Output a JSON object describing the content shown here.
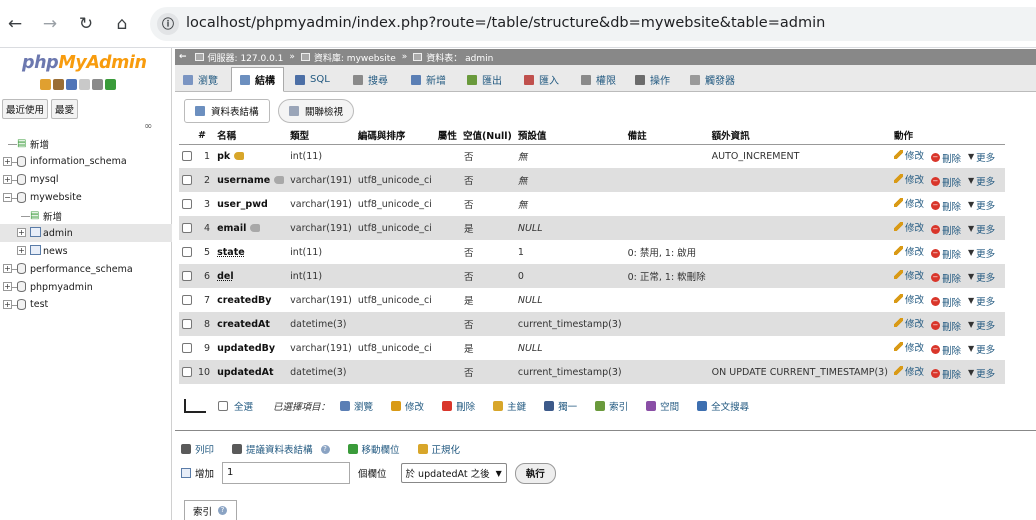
{
  "browser": {
    "url": "localhost/phpmyadmin/index.php?route=/table/structure&db=mywebsite&table=admin",
    "back_glyph": "←",
    "forward_glyph": "→",
    "reload_glyph": "↻",
    "home_glyph": "⌂",
    "info_glyph": "ⓘ"
  },
  "logo": {
    "part1": "php",
    "part2": "MyAdmin"
  },
  "left": {
    "recent_label": "最近使用",
    "favorites_label": "最愛",
    "link_glyph": "∞",
    "tree": [
      {
        "label": "新增",
        "level": 0,
        "kind": "new"
      },
      {
        "label": "information_schema",
        "level": 0,
        "kind": "db"
      },
      {
        "label": "mysql",
        "level": 0,
        "kind": "db"
      },
      {
        "label": "mywebsite",
        "level": 0,
        "kind": "db",
        "expanded": true
      },
      {
        "label": "新增",
        "level": 1,
        "kind": "new"
      },
      {
        "label": "admin",
        "level": 1,
        "kind": "table",
        "active": true
      },
      {
        "label": "news",
        "level": 1,
        "kind": "table"
      },
      {
        "label": "performance_schema",
        "level": 0,
        "kind": "db"
      },
      {
        "label": "phpmyadmin",
        "level": 0,
        "kind": "db"
      },
      {
        "label": "test",
        "level": 0,
        "kind": "db"
      }
    ]
  },
  "breadcrumb": {
    "back_glyph": "←",
    "server": "伺服器: 127.0.0.1",
    "database": "資料庫: mywebsite",
    "table": "資料表： admin",
    "separator": "»"
  },
  "tabs": [
    {
      "label": "瀏覽",
      "icon": "browse-icon",
      "active": false
    },
    {
      "label": "結構",
      "icon": "structure-icon",
      "active": true
    },
    {
      "label": "SQL",
      "icon": "sql-icon",
      "active": false
    },
    {
      "label": "搜尋",
      "icon": "search-icon",
      "active": false
    },
    {
      "label": "新增",
      "icon": "insert-icon",
      "active": false
    },
    {
      "label": "匯出",
      "icon": "export-icon",
      "active": false
    },
    {
      "label": "匯入",
      "icon": "import-icon",
      "active": false
    },
    {
      "label": "權限",
      "icon": "privileges-icon",
      "active": false
    },
    {
      "label": "操作",
      "icon": "operations-icon",
      "active": false
    },
    {
      "label": "觸發器",
      "icon": "triggers-icon",
      "active": false
    }
  ],
  "subtabs": {
    "structure": "資料表結構",
    "relation": "關聯檢視"
  },
  "table": {
    "headers": [
      "#",
      "名稱",
      "類型",
      "編碼與排序",
      "屬性",
      "空值(Null)",
      "預設值",
      "備註",
      "額外資訊",
      "動作"
    ],
    "rows": [
      {
        "num": "1",
        "name": "pk",
        "key": "primary",
        "type": "int(11)",
        "collation": "",
        "attr": "",
        "null": "否",
        "default": "無",
        "default_italic": true,
        "comment": "",
        "extra": "AUTO_INCREMENT"
      },
      {
        "num": "2",
        "name": "username",
        "key": "index",
        "type": "varchar(191)",
        "collation": "utf8_unicode_ci",
        "attr": "",
        "null": "否",
        "default": "無",
        "default_italic": true,
        "comment": "",
        "extra": ""
      },
      {
        "num": "3",
        "name": "user_pwd",
        "key": "",
        "type": "varchar(191)",
        "collation": "utf8_unicode_ci",
        "attr": "",
        "null": "否",
        "default": "無",
        "default_italic": true,
        "comment": "",
        "extra": ""
      },
      {
        "num": "4",
        "name": "email",
        "key": "index",
        "type": "varchar(191)",
        "collation": "utf8_unicode_ci",
        "attr": "",
        "null": "是",
        "default": "NULL",
        "default_italic": true,
        "comment": "",
        "extra": ""
      },
      {
        "num": "5",
        "name": "state",
        "key": "",
        "underline": true,
        "type": "int(11)",
        "collation": "",
        "attr": "",
        "null": "否",
        "default": "1",
        "default_italic": false,
        "comment": "0: 禁用, 1: 啟用",
        "extra": ""
      },
      {
        "num": "6",
        "name": "del",
        "key": "",
        "underline": true,
        "type": "int(11)",
        "collation": "",
        "attr": "",
        "null": "否",
        "default": "0",
        "default_italic": false,
        "comment": "0: 正常, 1: 軟刪除",
        "extra": ""
      },
      {
        "num": "7",
        "name": "createdBy",
        "key": "",
        "type": "varchar(191)",
        "collation": "utf8_unicode_ci",
        "attr": "",
        "null": "是",
        "default": "NULL",
        "default_italic": true,
        "comment": "",
        "extra": ""
      },
      {
        "num": "8",
        "name": "createdAt",
        "key": "",
        "type": "datetime(3)",
        "collation": "",
        "attr": "",
        "null": "否",
        "default": "current_timestamp(3)",
        "default_italic": false,
        "comment": "",
        "extra": ""
      },
      {
        "num": "9",
        "name": "updatedBy",
        "key": "",
        "type": "varchar(191)",
        "collation": "utf8_unicode_ci",
        "attr": "",
        "null": "是",
        "default": "NULL",
        "default_italic": true,
        "comment": "",
        "extra": ""
      },
      {
        "num": "10",
        "name": "updatedAt",
        "key": "",
        "type": "datetime(3)",
        "collation": "",
        "attr": "",
        "null": "否",
        "default": "current_timestamp(3)",
        "default_italic": false,
        "comment": "",
        "extra": "ON UPDATE CURRENT_TIMESTAMP(3)"
      }
    ],
    "actions": {
      "edit": "修改",
      "drop": "刪除",
      "more": "更多"
    }
  },
  "bulk": {
    "select_all": "全選",
    "with_selected": "已選擇項目：",
    "items": [
      {
        "label": "瀏覽",
        "icon": "browse-icon",
        "color": "#5b7fb5"
      },
      {
        "label": "修改",
        "icon": "pencil-icon",
        "color": "#d99a16"
      },
      {
        "label": "刪除",
        "icon": "drop-icon",
        "color": "#d9362b"
      },
      {
        "label": "主鍵",
        "icon": "primary-key-icon",
        "color": "#d8a62a"
      },
      {
        "label": "獨一",
        "icon": "unique-icon",
        "color": "#3d5a8a"
      },
      {
        "label": "索引",
        "icon": "index-icon",
        "color": "#6a9a3c"
      },
      {
        "label": "空間",
        "icon": "spatial-icon",
        "color": "#8a4fa6"
      },
      {
        "label": "全文搜尋",
        "icon": "fulltext-icon",
        "color": "#3d6fb0"
      }
    ]
  },
  "tools": [
    {
      "label": "列印",
      "icon": "print-icon"
    },
    {
      "label": "提議資料表結構",
      "icon": "propose-icon",
      "help": "?"
    },
    {
      "label": "移動欄位",
      "icon": "move-columns-icon"
    },
    {
      "label": "正規化",
      "icon": "normalize-icon"
    }
  ],
  "add_column": {
    "add_label": "增加",
    "count_value": "1",
    "columns_label": "個欄位",
    "position_value": "於 updatedAt 之後",
    "go_label": "執行"
  },
  "index_section": {
    "label": "索引",
    "help": "?"
  },
  "colors": {
    "link": "#235a81",
    "even_row": "#dfdfdf",
    "breadcrumb_bg": "#888888",
    "logo_php": "#6c78af",
    "logo_myadmin": "#f89c0e"
  }
}
